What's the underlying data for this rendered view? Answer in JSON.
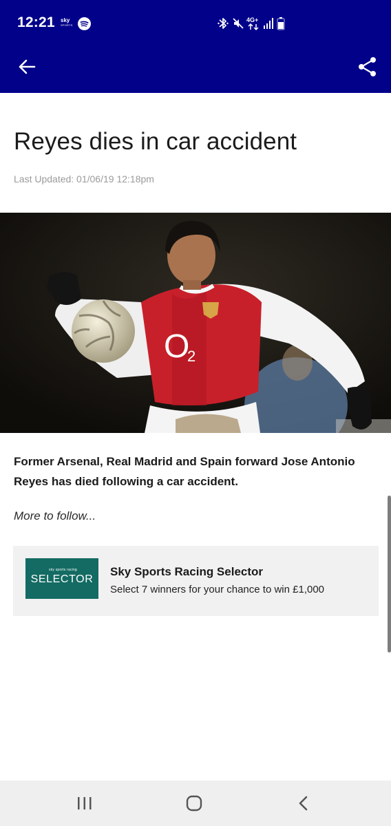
{
  "status_bar": {
    "time": "12:21",
    "sky_badge_top": "sky",
    "sky_badge_bottom": "SPORTS",
    "network_label": "4G+",
    "icons": [
      "sky-sports-icon",
      "spotify-icon",
      "bluetooth-icon",
      "mute-icon",
      "network-4g-icon",
      "signal-icon",
      "battery-icon"
    ]
  },
  "app_bar": {
    "back_icon": "back-arrow-icon",
    "share_icon": "share-icon",
    "background_color": "#01018a"
  },
  "article": {
    "headline": "Reyes dies in car accident",
    "last_updated": "Last Updated: 01/06/19 12:18pm",
    "photo_shirt_sponsor": "O2",
    "lead": "Former Arsenal, Real Madrid and Spain forward Jose Antonio Reyes has died following a car accident.",
    "more": "More to follow..."
  },
  "promo": {
    "logo_small": "sky sports racing",
    "logo_big": "SELECTOR",
    "title": "Sky Sports Racing Selector",
    "subtitle": "Select 7 winners for your chance to win £1,000",
    "logo_color": "#136b63"
  },
  "nav_bar": {
    "buttons": [
      "recent-apps-icon",
      "home-icon",
      "back-icon"
    ]
  }
}
